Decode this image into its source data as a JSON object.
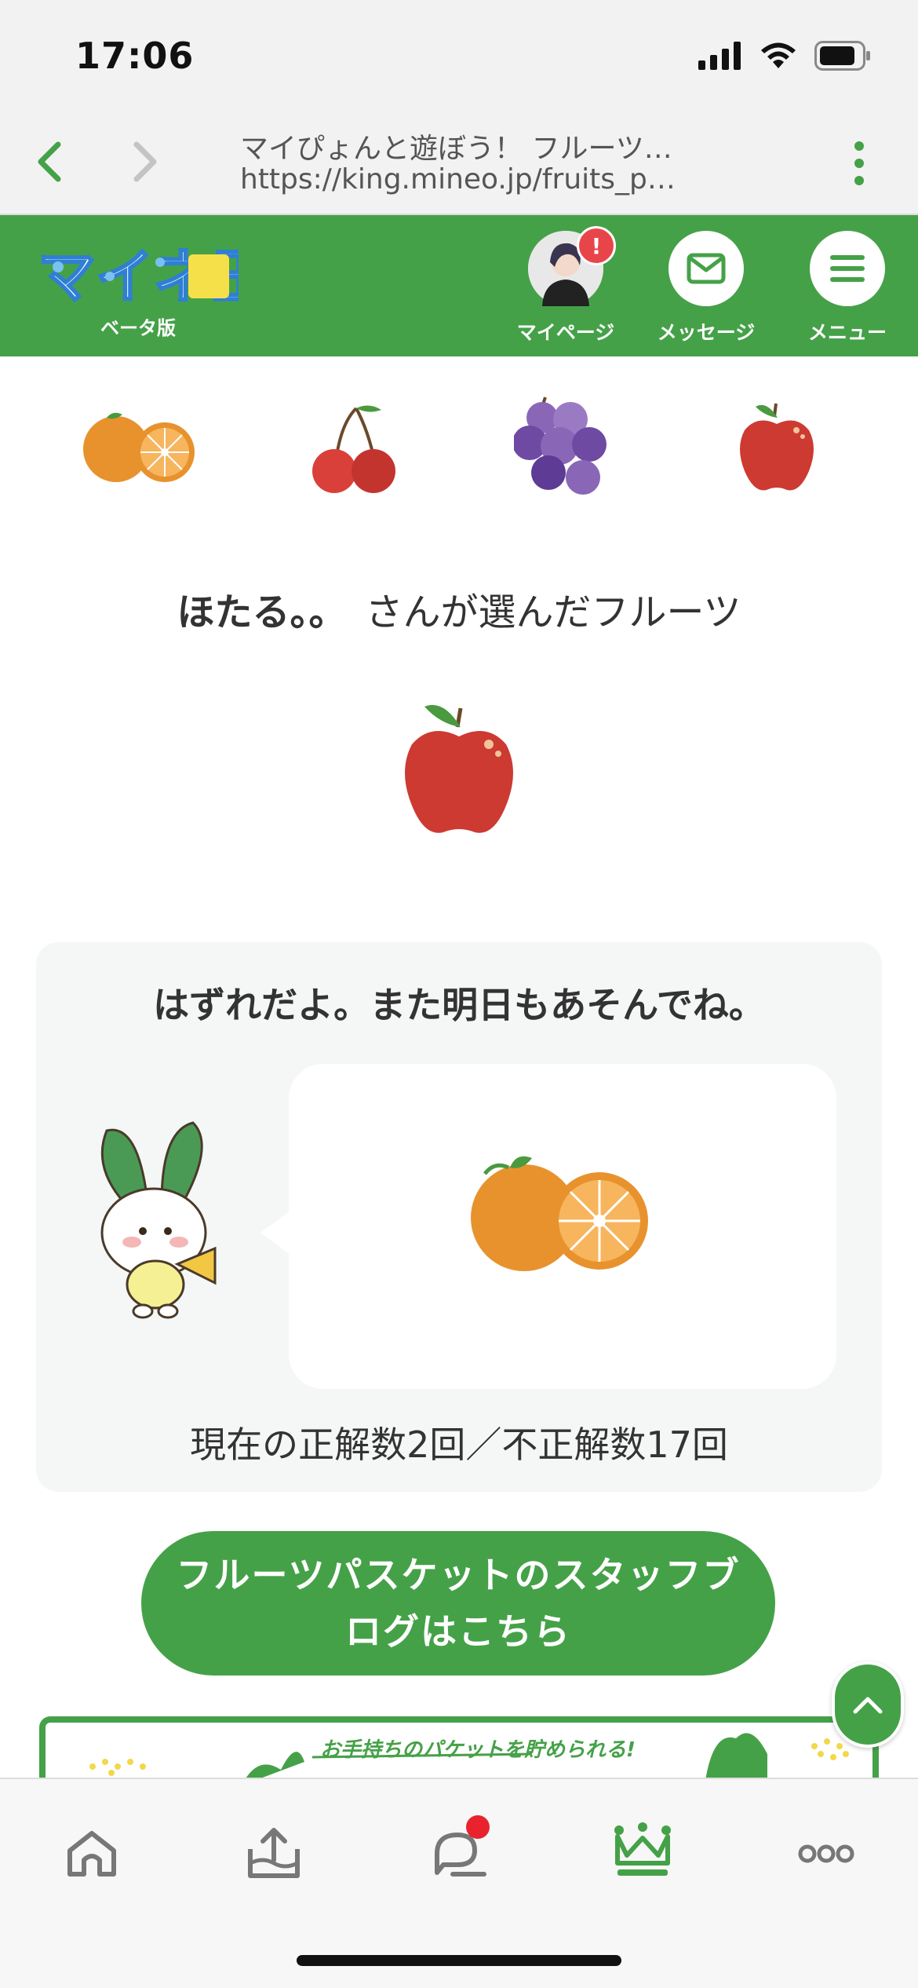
{
  "status_bar": {
    "time": "17:06"
  },
  "browser": {
    "title": "マイぴょんと遊ぼう！ フルーツ…",
    "url": "https://king.mineo.jp/fruits_p…"
  },
  "header": {
    "logo_text": "マイネ王",
    "logo_sub": "ベータ版",
    "mypage_label": "マイページ",
    "mypage_badge": "!",
    "message_label": "メッセージ",
    "menu_label": "メニュー",
    "brand_color": "#45a148"
  },
  "fruit_choices": [
    "orange-icon",
    "cherry-icon",
    "grape-icon",
    "apple-icon"
  ],
  "selection": {
    "user_name": "ほたる。。",
    "suffix": "さんが選んだフルーツ",
    "chosen_fruit": "apple-icon"
  },
  "result": {
    "title": "はずれだよ。また明日もあそんでね。",
    "mascot_fruit": "orange-icon",
    "score": "現在の正解数2回／不正解数17回"
  },
  "blog_button": {
    "line1": "フルーツパスケットのスタッフブ",
    "line2": "ログはこちら"
  },
  "banner": {
    "text": "お手持ちのパケットを貯められる!"
  },
  "tabs": [
    "home-icon",
    "upload-icon",
    "chat-icon",
    "crown-icon",
    "more-icon"
  ]
}
